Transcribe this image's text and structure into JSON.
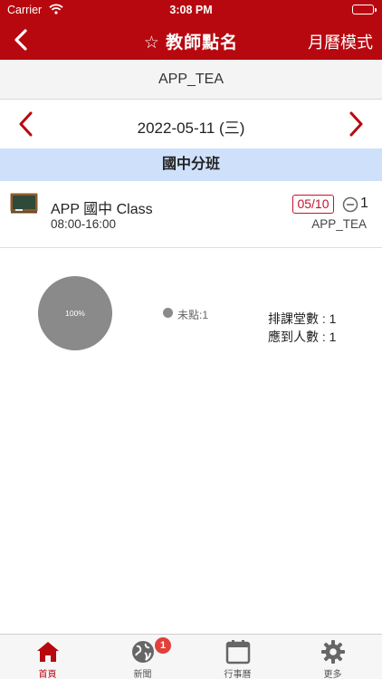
{
  "status_bar": {
    "carrier": "Carrier",
    "time": "3:08 PM"
  },
  "nav": {
    "title": "☆ 教師點名",
    "mode_label": "月曆模式"
  },
  "teacher_name": "APP_TEA",
  "date_label": "2022-05-11 (三)",
  "section_title": "國中分班",
  "class_item": {
    "name": "APP 國中 Class",
    "time": "08:00-16:00",
    "date_badge": "05/10",
    "count": "1",
    "teacher": "APP_TEA"
  },
  "chart_data": {
    "type": "pie",
    "slices": [
      {
        "label": "未點",
        "value": 1,
        "percent": 100
      }
    ],
    "slice_label": "100%",
    "legend": [
      "未點:1"
    ],
    "colors": [
      "#8a8a8a"
    ]
  },
  "stats": {
    "scheduled": "排課堂數 : 1",
    "expected": "應到人數 : 1"
  },
  "tabs": [
    {
      "label": "首頁",
      "icon": "home-icon",
      "active": true
    },
    {
      "label": "新聞",
      "icon": "globe-icon",
      "badge": "1"
    },
    {
      "label": "行事曆",
      "icon": "calendar-icon"
    },
    {
      "label": "更多",
      "icon": "gear-icon"
    }
  ],
  "colors": {
    "brand": "#b8080f",
    "section_bg": "#cfe0fb",
    "badge_red": "#e2403b"
  }
}
